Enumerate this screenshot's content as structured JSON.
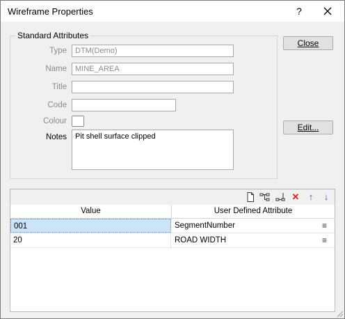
{
  "window": {
    "title": "Wireframe Properties",
    "help": "?"
  },
  "group": {
    "legend": "Standard Attributes"
  },
  "fields": {
    "type": {
      "label": "Type",
      "value": "DTM(Demo)"
    },
    "name": {
      "label": "Name",
      "value": "MINE_AREA"
    },
    "title": {
      "label": "Title",
      "value": ""
    },
    "code": {
      "label": "Code",
      "value": ""
    },
    "colour": {
      "label": "Colour"
    },
    "notes": {
      "label": "Notes",
      "value": "Pit shell surface clipped"
    }
  },
  "buttons": {
    "close": "Close",
    "edit": "Edit..."
  },
  "toolbar": {
    "icons": [
      "new-icon",
      "insert-child-icon",
      "insert-sibling-icon",
      "delete-icon",
      "move-up-icon",
      "move-down-icon"
    ],
    "colors": {
      "delete": "#d42222",
      "arrows": "#1f5fbf"
    }
  },
  "grid": {
    "headers": [
      "Value",
      "User Defined Attribute"
    ],
    "rows": [
      {
        "value": "001",
        "attribute": "SegmentNumber"
      },
      {
        "value": "20",
        "attribute": "ROAD WIDTH"
      }
    ],
    "selected_color": "#cce4f7"
  }
}
